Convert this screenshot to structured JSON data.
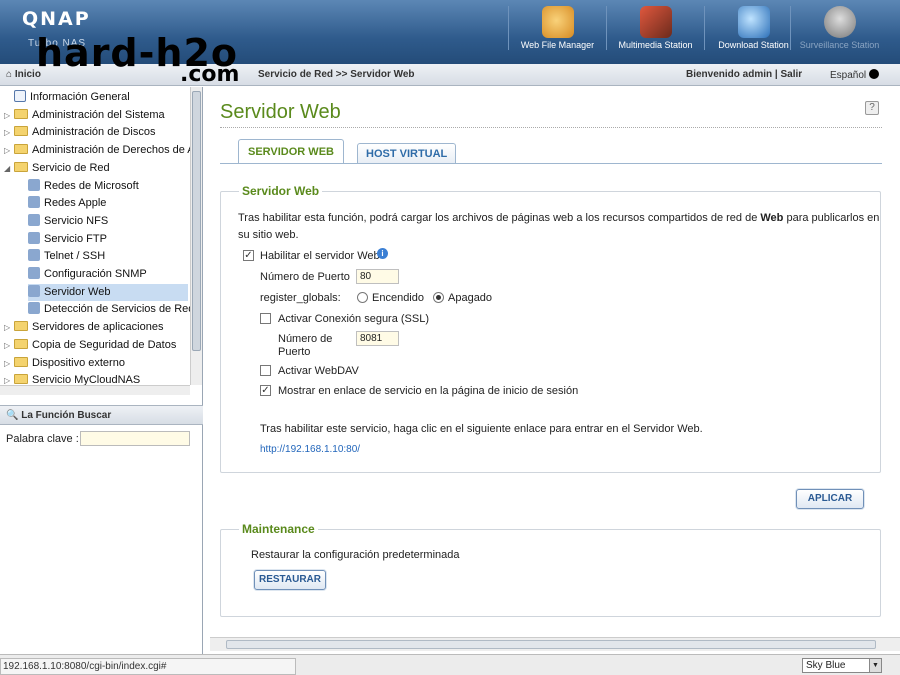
{
  "app": {
    "brand": "QNAP",
    "brand_sub": "Turbo NAS",
    "watermark_1": "hard-h2o",
    "watermark_2": ".com"
  },
  "toolbar": [
    {
      "label": "Web File Manager",
      "icon": "magnifier-folder-icon",
      "color": "#e6a23c"
    },
    {
      "label": "Multimedia Station",
      "icon": "film-clapper-icon",
      "color": "#c0392b"
    },
    {
      "label": "Download Station",
      "icon": "download-globe-icon",
      "color": "#3b7fc4"
    },
    {
      "label": "Surveillance Station",
      "icon": "dome-camera-icon",
      "color": "#8a8a8a"
    }
  ],
  "nav": {
    "home": "Inicio",
    "breadcrumb": "Servicio de Red >> Servidor Web",
    "welcome": "Bienvenido admin | Salir",
    "language": "Español"
  },
  "tree": [
    {
      "label": "Información General",
      "type": "page"
    },
    {
      "label": "Administración del Sistema",
      "type": "folder"
    },
    {
      "label": "Administración de Discos",
      "type": "folder"
    },
    {
      "label": "Administración de Derechos de Ac",
      "type": "folder"
    },
    {
      "label": "Servicio de Red",
      "type": "folder-open"
    },
    {
      "label": "Redes de Microsoft",
      "type": "sub"
    },
    {
      "label": "Redes Apple",
      "type": "sub"
    },
    {
      "label": "Servicio NFS",
      "type": "sub"
    },
    {
      "label": "Servicio FTP",
      "type": "sub"
    },
    {
      "label": "Telnet / SSH",
      "type": "sub"
    },
    {
      "label": "Configuración SNMP",
      "type": "sub"
    },
    {
      "label": "Servidor Web",
      "type": "sub-selected"
    },
    {
      "label": "Detección de Servicios de Red",
      "type": "sub"
    },
    {
      "label": "Servidores de aplicaciones",
      "type": "folder"
    },
    {
      "label": "Copia de Seguridad de Datos",
      "type": "folder"
    },
    {
      "label": "Dispositivo externo",
      "type": "folder"
    },
    {
      "label": "Servicio MyCloudNAS",
      "type": "folder"
    }
  ],
  "search": {
    "title": "La Función Buscar",
    "keyword_label": "Palabra clave :",
    "keyword_value": ""
  },
  "page": {
    "title": "Servidor Web",
    "tabs": [
      "SERVIDOR WEB",
      "HOST VIRTUAL"
    ],
    "web_section": {
      "legend": "Servidor Web",
      "description_1": "Tras habilitar esta función, podrá cargar los archivos de páginas web a los recursos compartidos de red de ",
      "description_bold": "Web",
      "description_2": " para publicarlos en",
      "description_3": "su sitio web.",
      "enable_label": "Habilitar el servidor Web",
      "enable_checked": true,
      "port_label": "Número de Puerto",
      "port_value": "80",
      "register_globals_label": "register_globals:",
      "register_on": "Encendido",
      "register_off": "Apagado",
      "register_selected": "Apagado",
      "ssl_label": "Activar Conexión segura (SSL)",
      "ssl_checked": false,
      "ssl_port_label_1": "Número de",
      "ssl_port_label_2": "Puerto",
      "ssl_port_value": "8081",
      "webdav_label": "Activar WebDAV",
      "webdav_checked": false,
      "show_link_label": "Mostrar en enlace de servicio en la página de inicio de sesión",
      "show_link_checked": true,
      "after_enable_text": "Tras habilitar este servicio, haga clic en el siguiente enlace para entrar en el Servidor Web.",
      "url": "http://192.168.1.10:80/"
    },
    "apply_button": "APLICAR",
    "maintenance": {
      "legend": "Maintenance",
      "text": "Restaurar la configuración predeterminada",
      "button": "RESTAURAR"
    }
  },
  "status": {
    "url": "192.168.1.10:8080/cgi-bin/index.cgi#",
    "theme": "Sky Blue"
  }
}
